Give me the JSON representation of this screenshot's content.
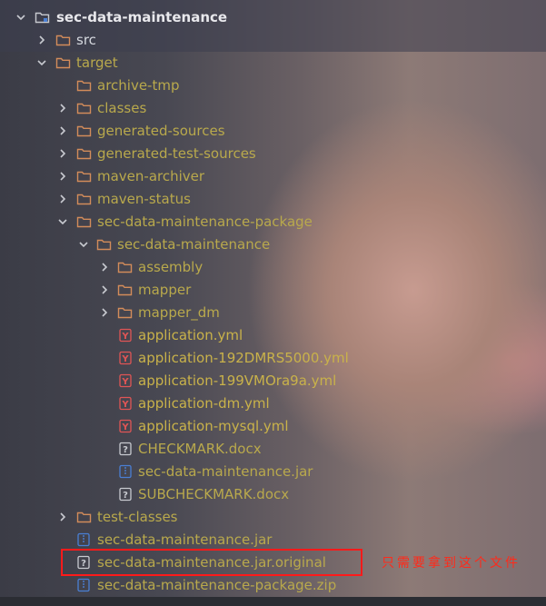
{
  "tree": {
    "rows": [
      {
        "label": "sec-data-maintenance",
        "icon": "module-folder-icon",
        "chevron": "down",
        "style": "bold"
      },
      {
        "label": "src",
        "icon": "folder-icon",
        "chevron": "right",
        "style": "light"
      },
      {
        "label": "target",
        "icon": "folder-icon",
        "chevron": "down",
        "style": "normal"
      },
      {
        "label": "archive-tmp",
        "icon": "folder-icon",
        "chevron": "none",
        "style": "normal"
      },
      {
        "label": "classes",
        "icon": "folder-icon",
        "chevron": "right",
        "style": "normal"
      },
      {
        "label": "generated-sources",
        "icon": "folder-icon",
        "chevron": "right",
        "style": "normal"
      },
      {
        "label": "generated-test-sources",
        "icon": "folder-icon",
        "chevron": "right",
        "style": "normal"
      },
      {
        "label": "maven-archiver",
        "icon": "folder-icon",
        "chevron": "right",
        "style": "normal"
      },
      {
        "label": "maven-status",
        "icon": "folder-icon",
        "chevron": "right",
        "style": "normal"
      },
      {
        "label": "sec-data-maintenance-package",
        "icon": "folder-icon",
        "chevron": "down",
        "style": "normal"
      },
      {
        "label": "sec-data-maintenance",
        "icon": "folder-icon",
        "chevron": "down",
        "style": "normal"
      },
      {
        "label": "assembly",
        "icon": "folder-icon",
        "chevron": "right",
        "style": "normal"
      },
      {
        "label": "mapper",
        "icon": "folder-icon",
        "chevron": "right",
        "style": "normal"
      },
      {
        "label": "mapper_dm",
        "icon": "folder-icon",
        "chevron": "right",
        "style": "normal"
      },
      {
        "label": "application.yml",
        "icon": "yaml-file-icon",
        "chevron": "none",
        "style": "normal"
      },
      {
        "label": "application-192DMRS5000.yml",
        "icon": "yaml-file-icon",
        "chevron": "none",
        "style": "normal"
      },
      {
        "label": "application-199VMOra9a.yml",
        "icon": "yaml-file-icon",
        "chevron": "none",
        "style": "normal"
      },
      {
        "label": "application-dm.yml",
        "icon": "yaml-file-icon",
        "chevron": "none",
        "style": "normal"
      },
      {
        "label": "application-mysql.yml",
        "icon": "yaml-file-icon",
        "chevron": "none",
        "style": "normal"
      },
      {
        "label": "CHECKMARK.docx",
        "icon": "unknown-file-icon",
        "chevron": "none",
        "style": "normal"
      },
      {
        "label": "sec-data-maintenance.jar",
        "icon": "archive-file-icon",
        "chevron": "none",
        "style": "normal"
      },
      {
        "label": "SUBCHECKMARK.docx",
        "icon": "unknown-file-icon",
        "chevron": "none",
        "style": "normal"
      },
      {
        "label": "test-classes",
        "icon": "folder-icon",
        "chevron": "right",
        "style": "normal"
      },
      {
        "label": "sec-data-maintenance.jar",
        "icon": "archive-file-icon",
        "chevron": "none",
        "style": "normal"
      },
      {
        "label": "sec-data-maintenance.jar.original",
        "icon": "unknown-file-icon",
        "chevron": "none",
        "style": "normal"
      },
      {
        "label": "sec-data-maintenance-package.zip",
        "icon": "archive-file-icon",
        "chevron": "none",
        "style": "normal"
      }
    ]
  },
  "annotation": {
    "text": "只需要拿到这个文件",
    "color": "#ff2a1a"
  },
  "colors": {
    "folder_stroke": "#d38c5a",
    "file_label": "#b9a94c",
    "yaml_icon": "#e05555",
    "archive_icon": "#4a7fd4",
    "highlight_border": "#ff1a1a"
  }
}
